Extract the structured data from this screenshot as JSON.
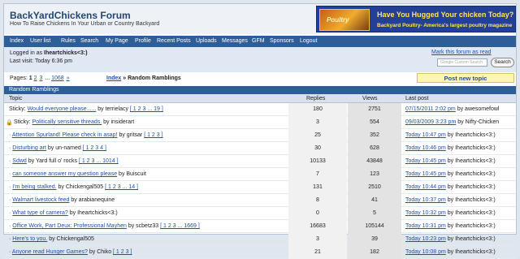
{
  "header": {
    "title": "BackYardChickens Forum",
    "subtitle": "How To Raise Chickens In Your Urban or Country Backyard",
    "ad_image_text": "Poultry",
    "ad_headline": "Have You Hugged Your chicken Today?",
    "ad_subline": "Backyard Poultry- America's largest poultry magazine"
  },
  "nav": [
    "Index",
    "User list",
    "Rules",
    "Search",
    "My Page",
    "Profile",
    "Recent Posts",
    "Uploads",
    "Messages",
    "GFM",
    "Sponsors",
    "Logout"
  ],
  "info": {
    "logged_prefix": "Logged in as ",
    "username": "Iheartchicks<3:)",
    "last_visit": "Last visit: Today 6:36 pm",
    "mark_read": "Mark this forum as read",
    "search_placeholder": "Google Custom Search",
    "search_button": "Search"
  },
  "pagination": {
    "label": "Pages:",
    "p1": "1",
    "p2": "2",
    "p3": "3",
    "sep": "...",
    "last": "1068",
    "next": "»"
  },
  "breadcrumb": {
    "index": "Index",
    "sep": " » ",
    "current": "Random Ramblings"
  },
  "new_topic": "Post new topic",
  "forum_title": "Random Ramblings",
  "columns": {
    "topic": "Topic",
    "replies": "Replies",
    "views": "Views",
    "last_post": "Last post"
  },
  "rows": [
    {
      "prefix": "Sticky:",
      "title": "Would everyone please......",
      "by": "by terrielacy",
      "pages": "[ 1 2 3 ... 19 ]",
      "replies": "180",
      "views": "2751",
      "last_date": "07/15/2011 2:02 pm",
      "last_by": "by awesomefowl",
      "lock": false
    },
    {
      "prefix": "Sticky:",
      "title": "Politically sensitive threads.",
      "by": "by insiderart",
      "pages": "",
      "replies": "3",
      "views": "554",
      "last_date": "09/03/2009 3:23 pm",
      "last_by": "by Nifty-Chicken",
      "lock": true
    },
    {
      "prefix": "·",
      "title": "Attention Spurland! Please check in asap!",
      "by": "by gritsar",
      "pages": "[ 1 2 3 ]",
      "replies": "25",
      "views": "352",
      "last_date": "Today 10:47 pm",
      "last_by": "by Iheartchicks<3:)",
      "lock": false
    },
    {
      "prefix": "·",
      "title": "Disturbing art",
      "by": "by un-named",
      "pages": "[ 1 2 3 4 ]",
      "replies": "30",
      "views": "628",
      "last_date": "Today 10:46 pm",
      "last_by": "by Iheartchicks<3:)",
      "lock": false
    },
    {
      "prefix": "·",
      "title": "Sdwd",
      "by": "by Yard full o' rocks",
      "pages": "[ 1 2 3 ... 1014 ]",
      "replies": "10133",
      "views": "43848",
      "last_date": "Today 10:45 pm",
      "last_by": "by Iheartchicks<3:)",
      "lock": false
    },
    {
      "prefix": "·",
      "title": "can someone answer my question please",
      "by": "by Buiscuit",
      "pages": "",
      "replies": "7",
      "views": "123",
      "last_date": "Today 10:45 pm",
      "last_by": "by Iheartchicks<3:)",
      "lock": false
    },
    {
      "prefix": "·",
      "title": "I'm being stalked.",
      "by": "by Chickengal505",
      "pages": "[ 1 2 3 ... 14 ]",
      "replies": "131",
      "views": "2510",
      "last_date": "Today 10:44 pm",
      "last_by": "by Iheartchicks<3:)",
      "lock": false
    },
    {
      "prefix": "·",
      "title": "Walmart livestock feed",
      "by": "by arabianequine",
      "pages": "",
      "replies": "8",
      "views": "41",
      "last_date": "Today 10:37 pm",
      "last_by": "by Iheartchicks<3:)",
      "lock": false
    },
    {
      "prefix": "·",
      "title": "What type of camera?",
      "by": "by Iheartchicks<3:)",
      "pages": "",
      "replies": "0",
      "views": "5",
      "last_date": "Today 10:32 pm",
      "last_by": "by Iheartchicks<3:)",
      "lock": false
    },
    {
      "prefix": "·",
      "title": "Office Work, Part Deux: Professional Mayhen",
      "by": "by scbetz33",
      "pages": "[ 1 2 3 ... 1669 ]",
      "replies": "16683",
      "views": "105144",
      "last_date": "Today 10:31 pm",
      "last_by": "by Iheartchicks<3:)",
      "lock": false
    },
    {
      "prefix": "·",
      "title": "Here's to you.",
      "by": "by Chickengal505",
      "pages": "",
      "replies": "3",
      "views": "39",
      "last_date": "Today 10:23 pm",
      "last_by": "by Iheartchicks<3:)",
      "lock": false
    },
    {
      "prefix": "·",
      "title": "Anyone read Hunger Games?",
      "by": "by Chiko",
      "pages": "[ 1 2 3 ]",
      "replies": "21",
      "views": "182",
      "last_date": "Today 10:08 pm",
      "last_by": "by Iheartchicks<3:)",
      "lock": false
    }
  ]
}
